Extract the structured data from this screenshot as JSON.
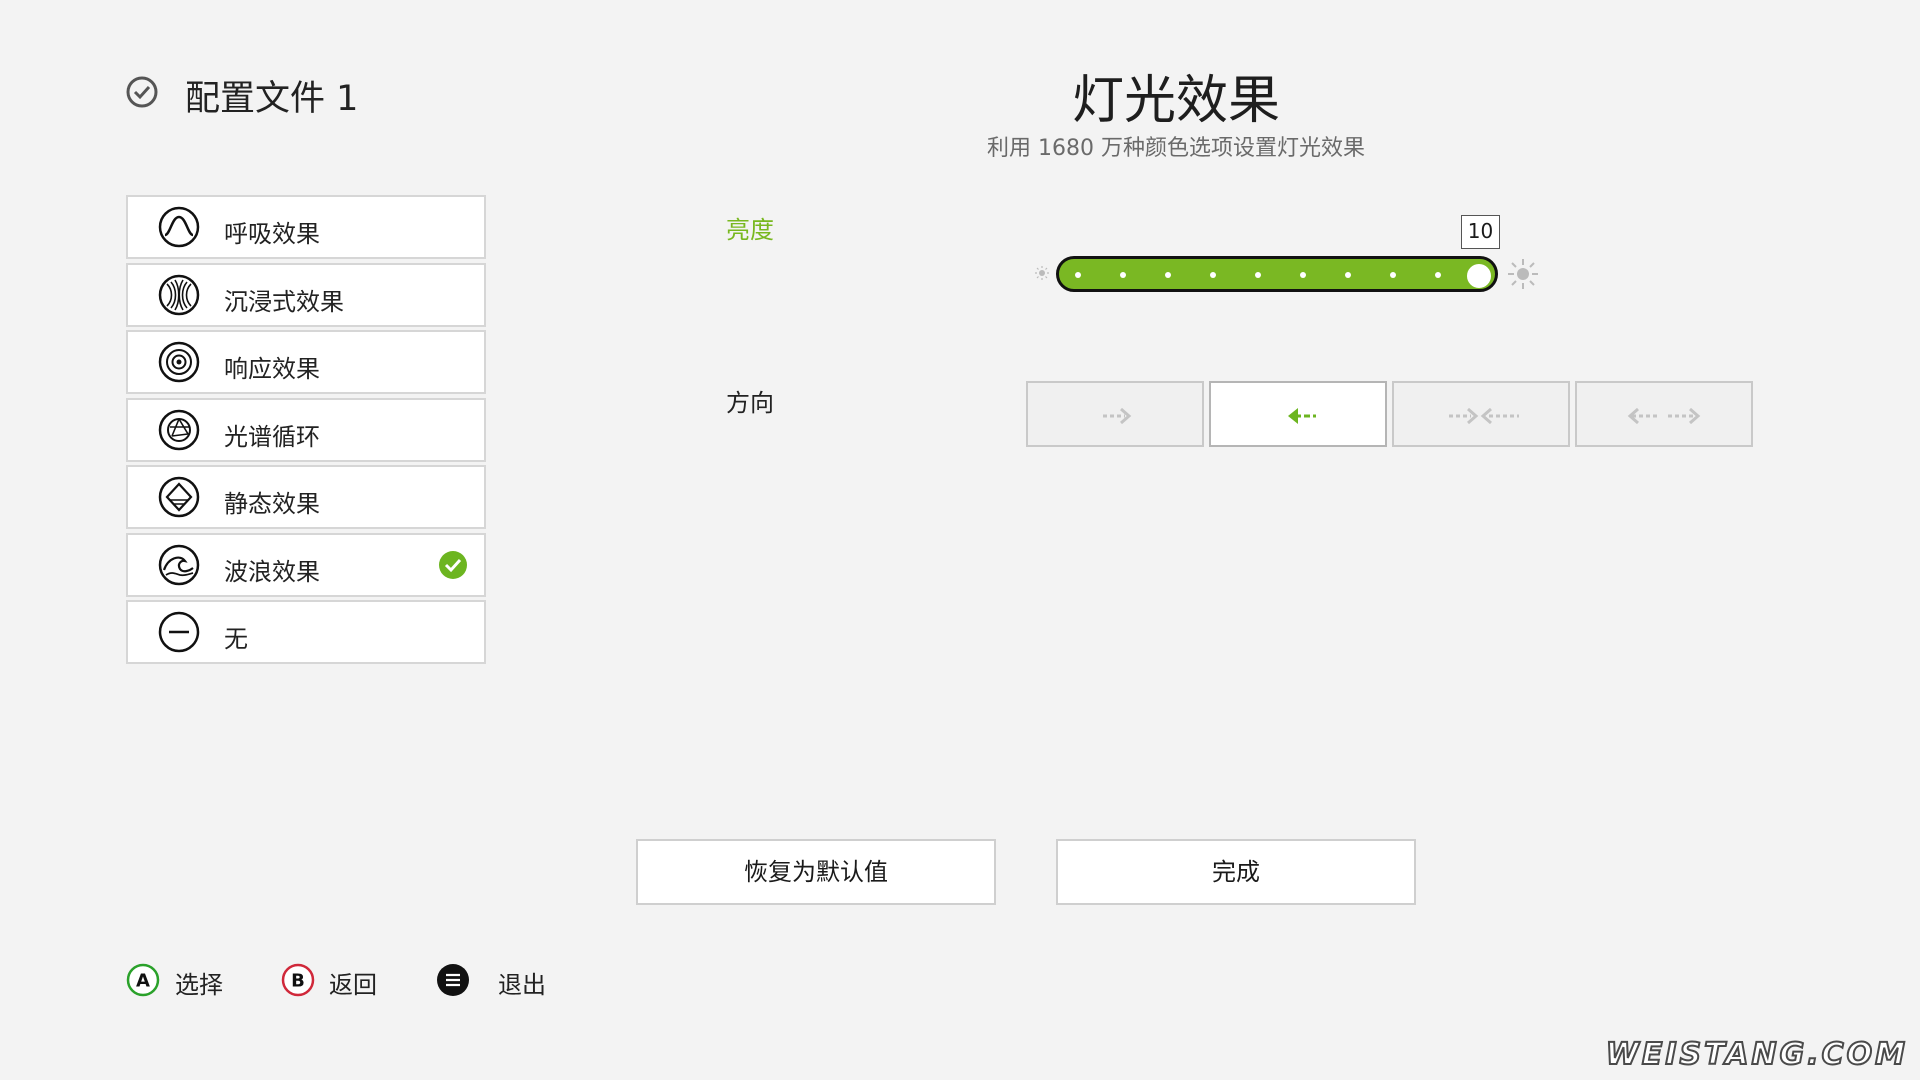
{
  "profile": {
    "title": "配置文件 1"
  },
  "header": {
    "title": "灯光效果",
    "subtitle": "利用 1680 万种颜色选项设置灯光效果"
  },
  "effects": [
    {
      "label": "呼吸效果",
      "icon": "breathing-icon",
      "selected": false
    },
    {
      "label": "沉浸式效果",
      "icon": "immersive-icon",
      "selected": false
    },
    {
      "label": "响应效果",
      "icon": "reactive-icon",
      "selected": false
    },
    {
      "label": "光谱循环",
      "icon": "spectrum-cycle-icon",
      "selected": false
    },
    {
      "label": "静态效果",
      "icon": "static-icon",
      "selected": false
    },
    {
      "label": "波浪效果",
      "icon": "wave-icon",
      "selected": true
    },
    {
      "label": "无",
      "icon": "none-icon",
      "selected": false
    }
  ],
  "brightness": {
    "label": "亮度",
    "value": "10",
    "max": "10"
  },
  "direction": {
    "label": "方向",
    "options": [
      "right-arrow",
      "left-arrow",
      "inward-arrows",
      "outward-arrows"
    ],
    "selected_index": 1
  },
  "buttons": {
    "reset": "恢复为默认值",
    "done": "完成"
  },
  "hints": [
    {
      "key": "A",
      "label": "选择",
      "color": "#2aa12a"
    },
    {
      "key": "B",
      "label": "返回",
      "color": "#d0283a"
    },
    {
      "key": "menu",
      "label": "退出",
      "color": "#111111"
    }
  ],
  "watermark": "WEISTANG.COM",
  "colors": {
    "accent": "#7ab823",
    "background": "#f3f3f3"
  }
}
